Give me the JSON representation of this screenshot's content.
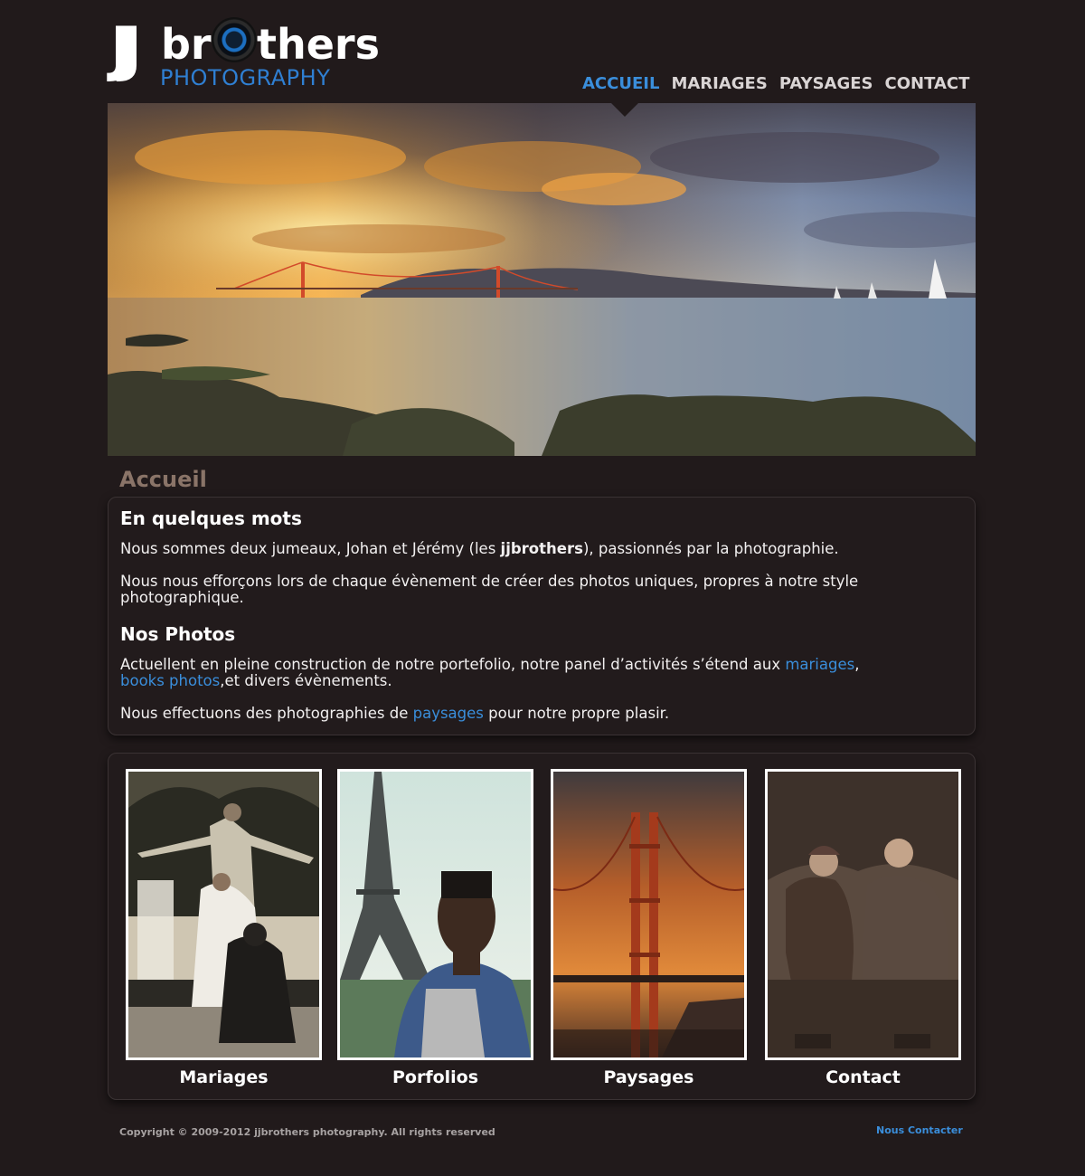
{
  "brand": {
    "logo_jj": "JJ",
    "logo_br": "br",
    "logo_thers": "thers",
    "logo_sub": "PHOTOGRAPHY"
  },
  "nav": {
    "items": [
      {
        "label": "ACCUEIL",
        "active": true
      },
      {
        "label": "MARIAGES",
        "active": false
      },
      {
        "label": "PAYSAGES",
        "active": false
      },
      {
        "label": "CONTACT",
        "active": false
      }
    ]
  },
  "page": {
    "title": "Accueil"
  },
  "about": {
    "heading1": "En quelques mots",
    "p1_before": "Nous sommes deux jumeaux, Johan et Jérémy (les ",
    "p1_bold": "jjbrothers",
    "p1_after": "), passionnés par la photographie.",
    "p2": "Nous nous efforçons lors de chaque évènement de créer des photos uniques, propres à notre style photographique.",
    "heading2": "Nos Photos",
    "p3_before": "Actuellent en pleine construction de notre portefolio, notre panel d’activités s’étend aux ",
    "p3_link1": "mariages",
    "p3_mid": ",",
    "p3_link2": "books photos",
    "p3_after": ",et divers évènements.",
    "p4_before": "Nous effectuons des photographies de ",
    "p4_link": "paysages",
    "p4_after": " pour notre propre plasir."
  },
  "gallery": {
    "cards": [
      {
        "caption": "Mariages"
      },
      {
        "caption": "Porfolios"
      },
      {
        "caption": "Paysages"
      },
      {
        "caption": "Contact"
      }
    ]
  },
  "footer": {
    "copyright": "Copyright © 2009-2012 jjbrothers photography. All rights reserved",
    "contact_link": "Nous Contacter"
  },
  "colors": {
    "background": "#211a1b",
    "accent": "#3a8edb",
    "title": "#8a7468"
  }
}
